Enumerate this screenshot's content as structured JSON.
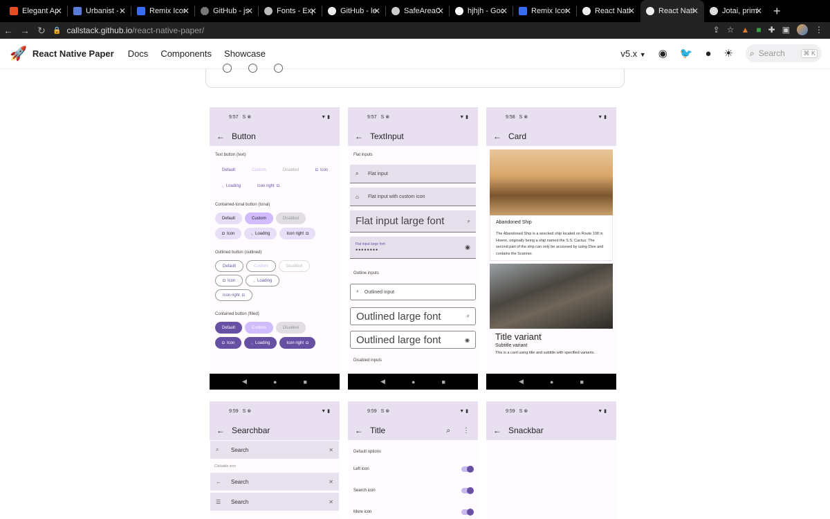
{
  "browser": {
    "tabs": [
      {
        "title": "Elegant App",
        "color": "#e44d26"
      },
      {
        "title": "Urbanist - Google Fonts",
        "color": "#5a7bd8"
      },
      {
        "title": "Remix Icon",
        "color": "#3b6cf5"
      },
      {
        "title": "GitHub - jsx",
        "color": "#777777"
      },
      {
        "title": "Fonts - Expo",
        "color": "#bbbbbb"
      },
      {
        "title": "GitHub - lexical",
        "color": "#eeeeee"
      },
      {
        "title": "SafeAreaContext",
        "color": "#cccccc"
      },
      {
        "title": "hjhjh - Google Search",
        "color": "#ffffff"
      },
      {
        "title": "Remix Icon",
        "color": "#3b6cf5"
      },
      {
        "title": "React Native Paper",
        "color": "#eeeeee"
      },
      {
        "title": "React Native Paper",
        "color": "#eeeeee"
      },
      {
        "title": "Jotai, primitive",
        "color": "#dddddd"
      }
    ],
    "url_host": "callstack.github.io",
    "url_path": "/react-native-paper/"
  },
  "site": {
    "brand": "React Native Paper",
    "nav": [
      "Docs",
      "Components",
      "Showcase"
    ],
    "version": "v5.x",
    "search_placeholder": "Search",
    "search_kbd": "⌘ K"
  },
  "screens": {
    "button": {
      "time": "9:57",
      "title": "Button",
      "sections": [
        "Text button (text)",
        "Contained-tonal button (tonal)",
        "Outlined button (outlined)",
        "Contained button (filled)"
      ],
      "labels": {
        "default": "Default",
        "custom": "Custom",
        "disabled": "Disabled",
        "icon": "Icon",
        "loading": "Loading",
        "icon_right": "Icon right"
      }
    },
    "textinput": {
      "time": "9:57",
      "title": "TextInput",
      "flat_section": "Flat inputs",
      "flat_input": "Flat input",
      "flat_custom_icon": "Flat input with custom icon",
      "flat_large": "Flat input large font",
      "flat_large_label": "Flat input large font",
      "password": "••••••••",
      "outline_section": "Outline inputs",
      "outlined_input": "Outlined input",
      "outlined_large": "Outlined large font",
      "disabled_section": "Disabled inputs"
    },
    "card": {
      "time": "9:58",
      "title": "Card",
      "card1_title": "Abandoned Ship",
      "card1_body": "The Abandoned Ship is a wrecked ship located on Route 108 in Hoenn, originally being a ship named the S.S. Cactus. The second part of the ship can only be accessed by using Dive and contains the Scanner.",
      "card2_title": "Title variant",
      "card2_subtitle": "Subtitle variant",
      "card2_body": "This is a card using title and subtitle with specified variants."
    },
    "searchbar": {
      "time": "9:59",
      "title": "Searchbar",
      "search1": "Search",
      "clickable_label": "Clickable icon",
      "search2": "Search",
      "search3": "Search"
    },
    "titlescreen": {
      "time": "9:59",
      "title": "Title",
      "section": "Default options",
      "options": [
        "Left icon",
        "Search icon",
        "More icon"
      ]
    },
    "snackbar": {
      "time": "9:59",
      "title": "Snackbar"
    }
  },
  "colors": {
    "primary": "#6750a4",
    "surface": "#e8e0f0"
  }
}
